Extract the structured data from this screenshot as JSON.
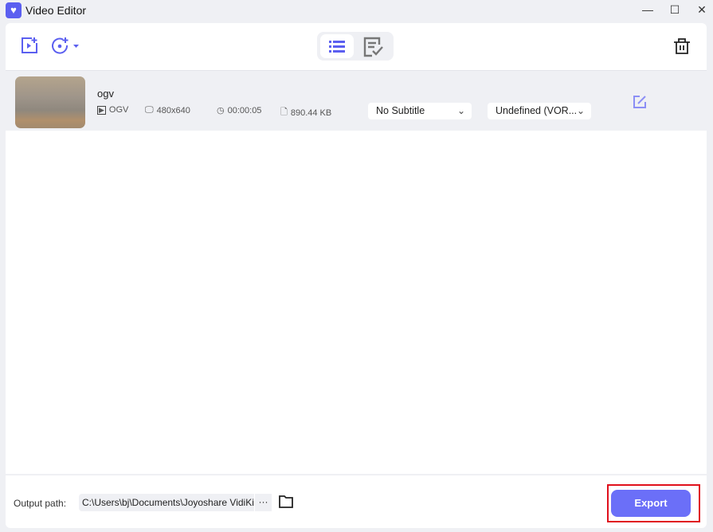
{
  "window": {
    "title": "Video Editor",
    "minimize": "—",
    "maximize": "☐",
    "close": "✕"
  },
  "file": {
    "name": "ogv",
    "format": "OGV",
    "resolution": "480x640",
    "duration": "00:00:05",
    "size": "890.44 KB",
    "subtitle": "No Subtitle",
    "audio": "Undefined (VOR..."
  },
  "footer": {
    "output_label": "Output path:",
    "output_path": "C:\\Users\\bj\\Documents\\Joyoshare VidiKit",
    "more": "···",
    "export_label": "Export"
  },
  "colors": {
    "accent": "#6b6ff8",
    "highlight": "#e0101c"
  }
}
